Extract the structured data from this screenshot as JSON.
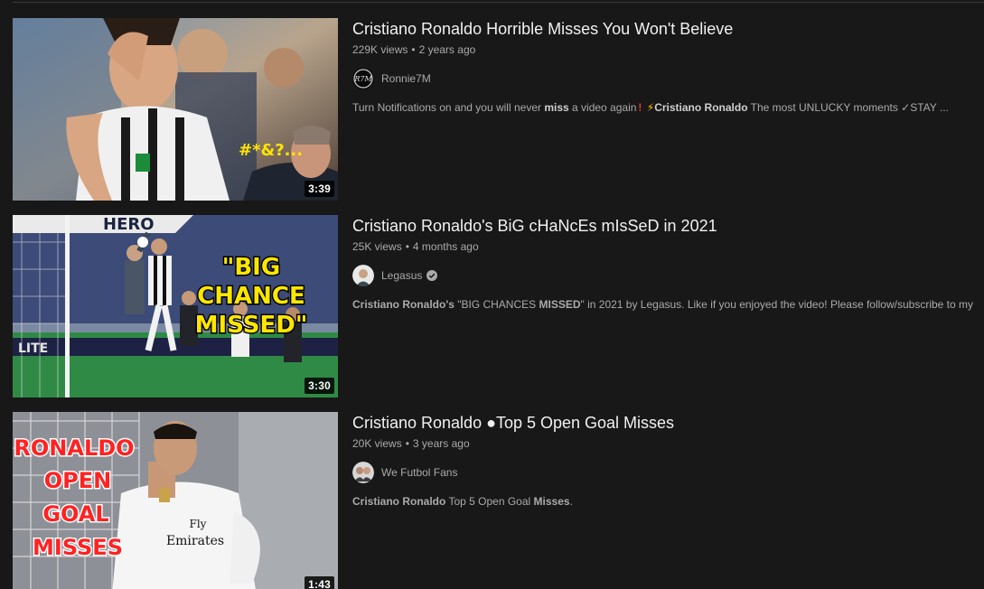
{
  "results": [
    {
      "title": "Cristiano Ronaldo Horrible Misses You Won't Believe",
      "views": "229K views",
      "age": "2 years ago",
      "channel": "Ronnie7M",
      "verified": false,
      "duration": "3:39",
      "thumb_overlay": "#*&?...",
      "desc": {
        "p1": "Turn Notifications on and you will never ",
        "b1": "miss",
        "p2": " a video again",
        "icon1": "red-exclamation",
        "icon2": "lightning",
        "b2": "Cristiano Ronaldo",
        "p3": " The most UNLUCKY moments ✓STAY ..."
      }
    },
    {
      "title": "Cristiano Ronaldo's BiG cHaNcEs mIsSeD in 2021",
      "views": "25K views",
      "age": "4 months ago",
      "channel": "Legasus",
      "verified": true,
      "duration": "3:30",
      "thumb_overlay": [
        "\"BIG",
        "CHANCE",
        "MISSED\""
      ],
      "thumb_banner": "HERO",
      "thumb_ad": "LITE",
      "desc": {
        "b1": "Cristiano Ronaldo's",
        "p1": " \"BIG CHANCES ",
        "b2": "MISSED",
        "p2": "\" in 2021 by Legasus. Like if you enjoyed the video! Please follow/subscribe to my"
      }
    },
    {
      "title": "Cristiano Ronaldo ●Top 5 Open Goal Misses",
      "views": "20K views",
      "age": "3 years ago",
      "channel": "We Futbol Fans",
      "verified": false,
      "duration": "1:43",
      "thumb_overlay": [
        "RONALDO",
        "OPEN",
        "GOAL",
        "MISSES"
      ],
      "thumb_shirt": [
        "Fly",
        "Emirates"
      ],
      "desc": {
        "b1": "Cristiano Ronaldo",
        "p1": " Top 5 Open Goal ",
        "b2": "Misses",
        "p2": "."
      }
    }
  ],
  "meta_separator": "•",
  "colors": {
    "background": "#181818",
    "title": "#f1f1f1",
    "meta": "#aaaaaa"
  }
}
